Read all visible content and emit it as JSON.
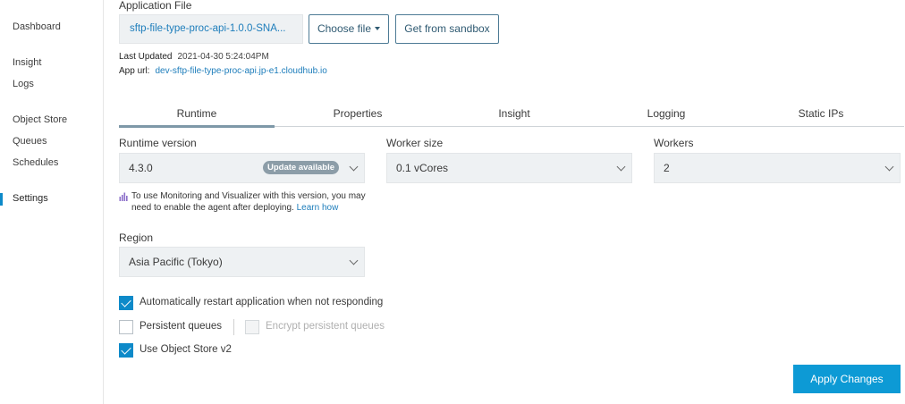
{
  "sidebar": {
    "items": [
      {
        "label": "Dashboard"
      },
      {
        "label": "Insight"
      },
      {
        "label": "Logs"
      },
      {
        "label": "Object Store"
      },
      {
        "label": "Queues"
      },
      {
        "label": "Schedules"
      },
      {
        "label": "Settings",
        "active": true
      }
    ]
  },
  "app_file": {
    "label": "Application File",
    "file_name": "sftp-file-type-proc-api-1.0.0-SNA...",
    "choose_file_label": "Choose file",
    "sandbox_label": "Get from sandbox",
    "last_updated_label": "Last Updated",
    "last_updated_value": "2021-04-30 5:24:04PM",
    "app_url_label": "App url:",
    "app_url_value": "dev-sftp-file-type-proc-api.jp-e1.cloudhub.io"
  },
  "tabs": [
    {
      "label": "Runtime",
      "active": true
    },
    {
      "label": "Properties"
    },
    {
      "label": "Insight"
    },
    {
      "label": "Logging"
    },
    {
      "label": "Static IPs"
    }
  ],
  "runtime": {
    "version_label": "Runtime version",
    "version_value": "4.3.0",
    "update_badge": "Update available",
    "worker_size_label": "Worker size",
    "worker_size_value": "0.1 vCores",
    "workers_label": "Workers",
    "workers_value": "2",
    "info_text": "To use Monitoring and Visualizer with this version, you may need to enable the agent after deploying.",
    "info_link": "Learn how",
    "region_label": "Region",
    "region_value": "Asia Pacific (Tokyo)"
  },
  "options": {
    "auto_restart": {
      "label": "Automatically restart application when not responding",
      "checked": true
    },
    "persistent_queues": {
      "label": "Persistent queues",
      "checked": false
    },
    "encrypt_queues": {
      "label": "Encrypt persistent queues",
      "checked": false,
      "disabled": true
    },
    "object_store_v2": {
      "label": "Use Object Store v2",
      "checked": true
    }
  },
  "apply_label": "Apply Changes",
  "colors": {
    "accent": "#0d8ac9",
    "apply_button": "#0d9ad5",
    "link": "#1d7dbb",
    "badge": "#8c9da8",
    "field_bg": "#eef1f3"
  }
}
